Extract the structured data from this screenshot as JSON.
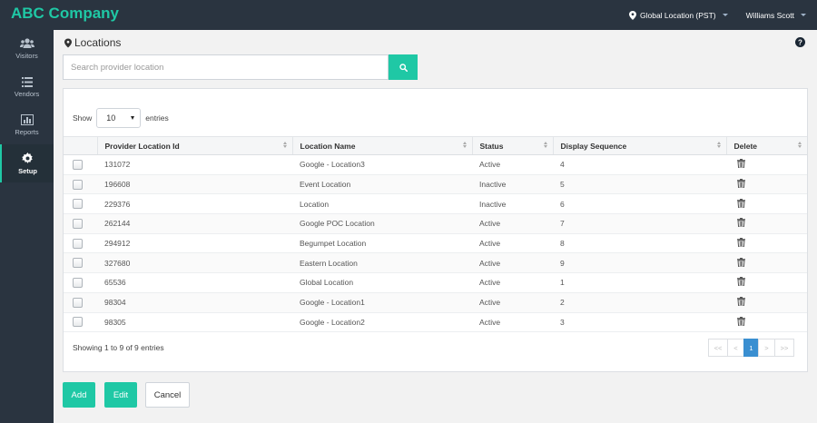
{
  "app": {
    "brand": "ABC Company"
  },
  "topbar": {
    "location": "Global Location (PST)",
    "user": "Williams Scott"
  },
  "sidebar": {
    "items": [
      {
        "label": "Visitors",
        "icon": "users-icon"
      },
      {
        "label": "Vendors",
        "icon": "list-icon"
      },
      {
        "label": "Reports",
        "icon": "bar-chart-icon"
      },
      {
        "label": "Setup",
        "icon": "gear-icon",
        "active": true
      }
    ]
  },
  "page": {
    "title": "Locations"
  },
  "search": {
    "placeholder": "Search provider location",
    "value": ""
  },
  "table_controls": {
    "show_label": "Show",
    "entries_value": "10",
    "entries_label": "entries"
  },
  "table": {
    "columns": [
      "Provider Location Id",
      "Location Name",
      "Status",
      "Display Sequence",
      "Delete"
    ],
    "rows": [
      {
        "id": "131072",
        "name": "Google - Location3",
        "status": "Active",
        "seq": "4"
      },
      {
        "id": "196608",
        "name": "Event Location",
        "status": "Inactive",
        "seq": "5"
      },
      {
        "id": "229376",
        "name": "Location",
        "status": "Inactive",
        "seq": "6"
      },
      {
        "id": "262144",
        "name": "Google POC Location",
        "status": "Active",
        "seq": "7"
      },
      {
        "id": "294912",
        "name": "Begumpet Location",
        "status": "Active",
        "seq": "8"
      },
      {
        "id": "327680",
        "name": "Eastern Location",
        "status": "Active",
        "seq": "9"
      },
      {
        "id": "65536",
        "name": "Global Location",
        "status": "Active",
        "seq": "1"
      },
      {
        "id": "98304",
        "name": "Google - Location1",
        "status": "Active",
        "seq": "2"
      },
      {
        "id": "98305",
        "name": "Google - Location2",
        "status": "Active",
        "seq": "3"
      }
    ]
  },
  "footer": {
    "info": "Showing 1 to 9 of 9 entries"
  },
  "pagination": {
    "first": "<<",
    "prev": "<",
    "current": "1",
    "next": ">",
    "last": ">>"
  },
  "actions": {
    "add": "Add",
    "edit": "Edit",
    "cancel": "Cancel"
  },
  "colors": {
    "accent": "#1fc8a5",
    "sidebar": "#2a3440",
    "page_active": "#3a8fd1"
  }
}
